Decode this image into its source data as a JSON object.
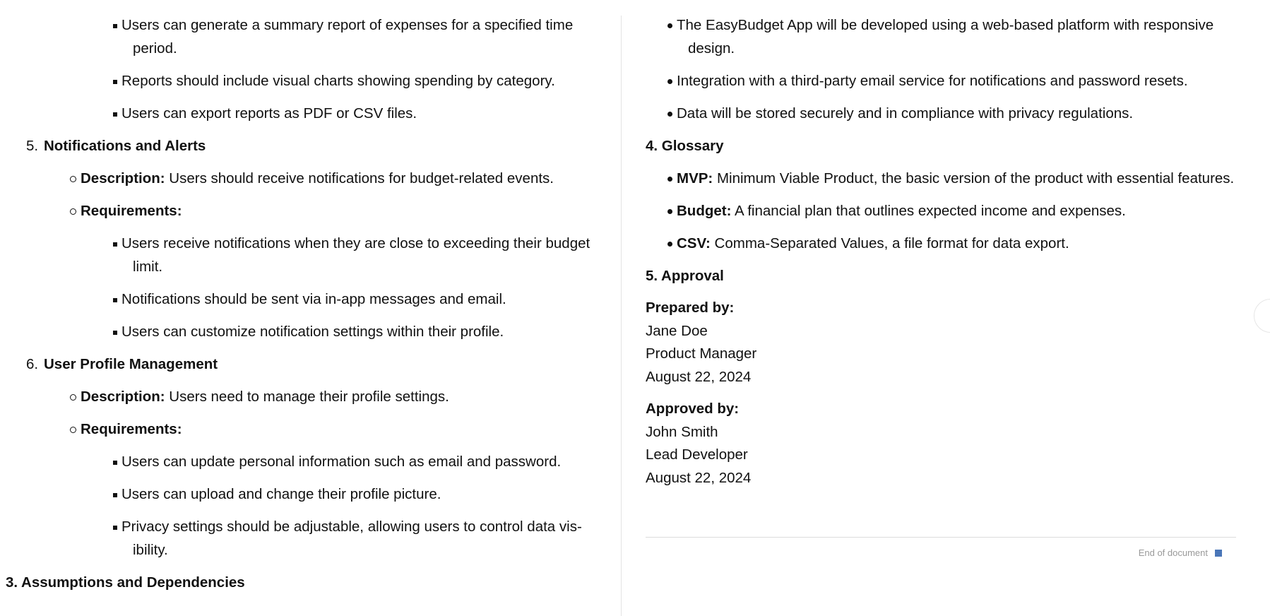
{
  "left": {
    "r1": [
      "Users can generate a summary report of expenses for a specified time",
      "period."
    ],
    "r2": "Reports should include visual charts showing spending by category.",
    "r3": "Users can export reports as PDF or CSV files.",
    "s5": {
      "num": "5.",
      "title": "Notifications and Alerts",
      "desc_label": "Description:",
      "desc": " Users should receive notifications for budget-related events.",
      "req_label": "Requirements:",
      "items": [
        [
          "Users receive notifications when they are close to exceeding their budget",
          "limit."
        ],
        "Notifications should be sent via in-app messages and email.",
        "Users can customize notification settings within their profile."
      ]
    },
    "s6": {
      "num": "6.",
      "title": "User Profile Management",
      "desc_label": "Description:",
      "desc": " Users need to manage their profile settings.",
      "req_label": "Requirements:",
      "items": [
        "Users can update personal information such as email and password.",
        "Users can upload and change their profile picture.",
        [
          "Privacy settings should be adjustable, allowing users to control data vis-",
          "ibility."
        ]
      ]
    },
    "h3": "3. Assumptions and Dependencies"
  },
  "right": {
    "assumptions": [
      [
        "The EasyBudget App will be developed using a web-based platform with responsive",
        "design."
      ],
      "Integration with a third-party email service for notifications and password resets.",
      "Data will be stored securely and in compliance with privacy regulations."
    ],
    "glossary_heading": "4. Glossary",
    "glossary": [
      {
        "term": "MVP:",
        "def": " Minimum Viable Product, the basic version of the product with essential features."
      },
      {
        "term": "Budget:",
        "def": " A financial plan that outlines expected income and expenses."
      },
      {
        "term": "CSV:",
        "def": " Comma-Separated Values, a file format for data export."
      }
    ],
    "approval_heading": "5. Approval",
    "prepared": {
      "label": "Prepared by:",
      "name": "Jane Doe",
      "role": "Product Manager",
      "date": "August 22, 2024"
    },
    "approved": {
      "label": "Approved by:",
      "name": "John Smith",
      "role": "Lead Developer",
      "date": "August 22, 2024"
    },
    "end_note": "End of document"
  },
  "colors": {
    "accent": "#4a76b8",
    "divider": "#e3e3e3"
  }
}
